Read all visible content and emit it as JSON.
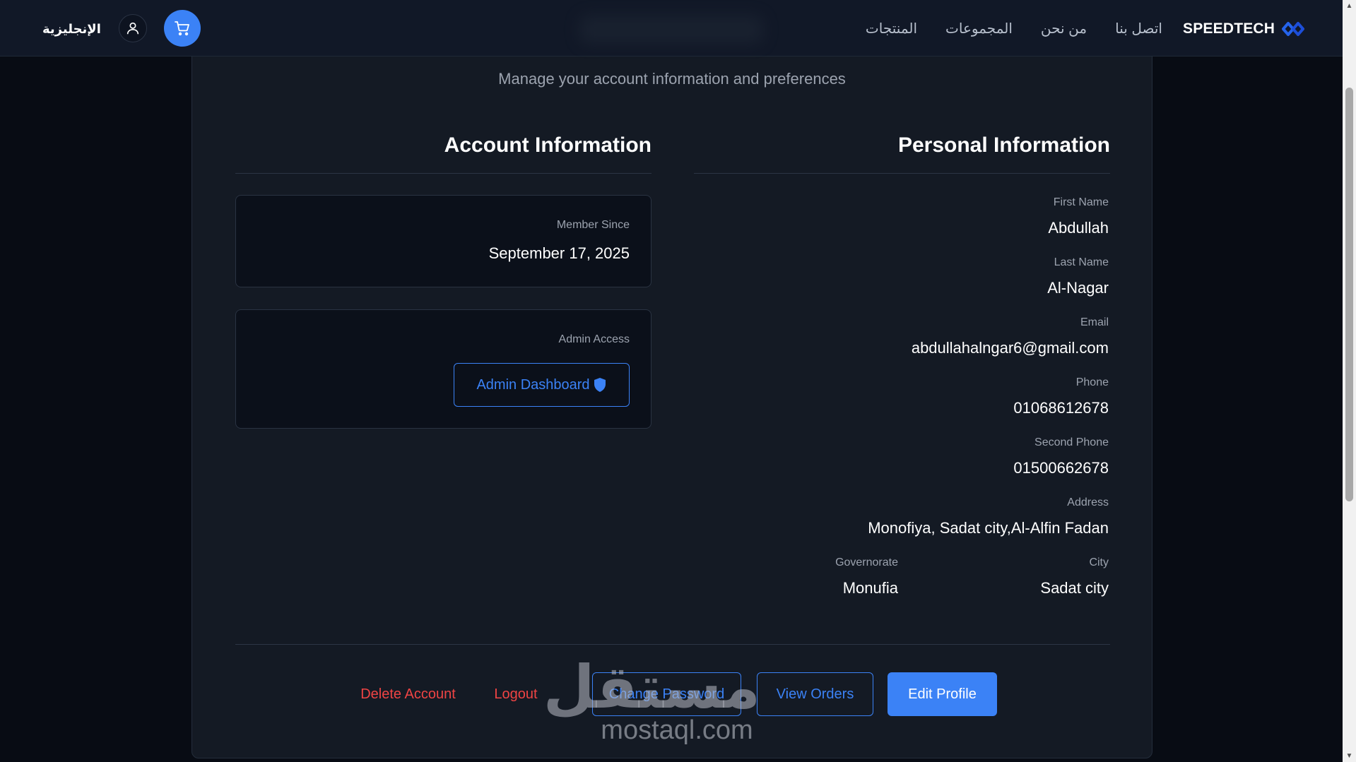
{
  "header": {
    "language_label": "الإنجليزية",
    "brand_name": "SPEEDTECH",
    "nav_items": [
      "المنتجات",
      "المجموعات",
      "من نحن",
      "اتصل بنا"
    ],
    "user_icon": "user-icon",
    "cart_icon": "cart-icon"
  },
  "page": {
    "subtitle": "Manage your account information and preferences"
  },
  "account": {
    "title": "Account Information",
    "member_since_label": "Member Since",
    "member_since_value": "September 17, 2025",
    "admin_access_label": "Admin Access",
    "admin_button_label": "Admin Dashboard",
    "admin_button_icon": "shield-icon"
  },
  "personal": {
    "title": "Personal Information",
    "first_name_label": "First Name",
    "first_name": "Abdullah",
    "last_name_label": "Last Name",
    "last_name": "Al-Nagar",
    "email_label": "Email",
    "email": "abdullahalngar6@gmail.com",
    "phone_label": "Phone",
    "phone": "01068612678",
    "second_phone_label": "Second Phone",
    "second_phone": "01500662678",
    "address_label": "Address",
    "address": "Monofiya, Sadat city,Al-Alfin Fadan",
    "city_label": "City",
    "city": "Sadat city",
    "governorate_label": "Governorate",
    "governorate": "Monufia"
  },
  "actions": {
    "delete_account": "Delete Account",
    "logout": "Logout",
    "change_password": "Change Password",
    "view_orders": "View Orders",
    "edit_profile": "Edit Profile"
  },
  "watermark": {
    "arabic": "مستقل",
    "latin": "mostaql.com"
  },
  "colors": {
    "accent": "#3b82f6",
    "danger": "#ef4444",
    "card_bg": "#141a24",
    "page_bg": "#080c14"
  }
}
